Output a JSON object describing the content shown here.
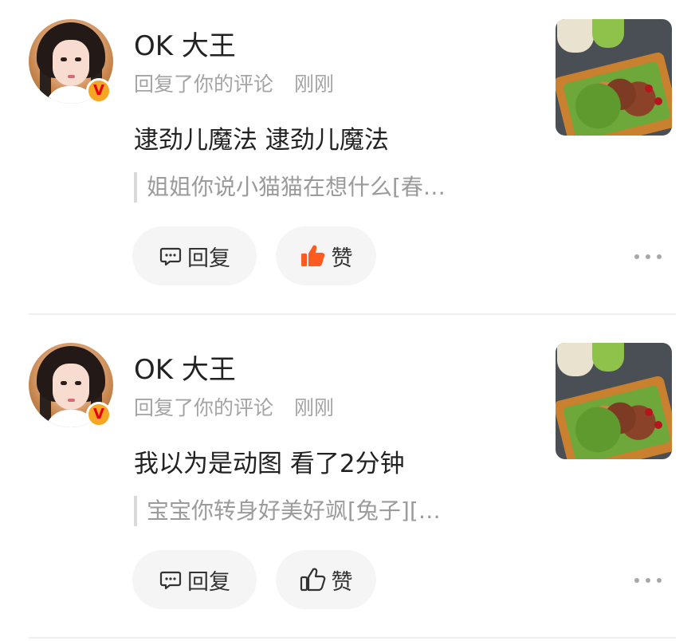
{
  "notifications": [
    {
      "username": "OK 大王",
      "action": "回复了你的评论",
      "time": "刚刚",
      "comment": "逮劲儿魔法 逮劲儿魔法",
      "quoted": "姐姐你说小猫猫在想什么[春…",
      "reply_label": "回复",
      "like_label": "赞",
      "like_active": true,
      "like_color": "#ff5a1f",
      "badge": "V"
    },
    {
      "username": "OK 大王",
      "action": "回复了你的评论",
      "time": "刚刚",
      "comment": "我以为是动图 看了2分钟",
      "quoted": "宝宝你转身好美好飒[兔子][…",
      "reply_label": "回复",
      "like_label": "赞",
      "like_active": false,
      "like_color": "#333333",
      "badge": "V"
    }
  ],
  "icons": {
    "reply": "comment-bubble-icon",
    "like": "thumbs-up-icon",
    "more": "more-dots-icon",
    "verified": "verified-badge-icon"
  }
}
